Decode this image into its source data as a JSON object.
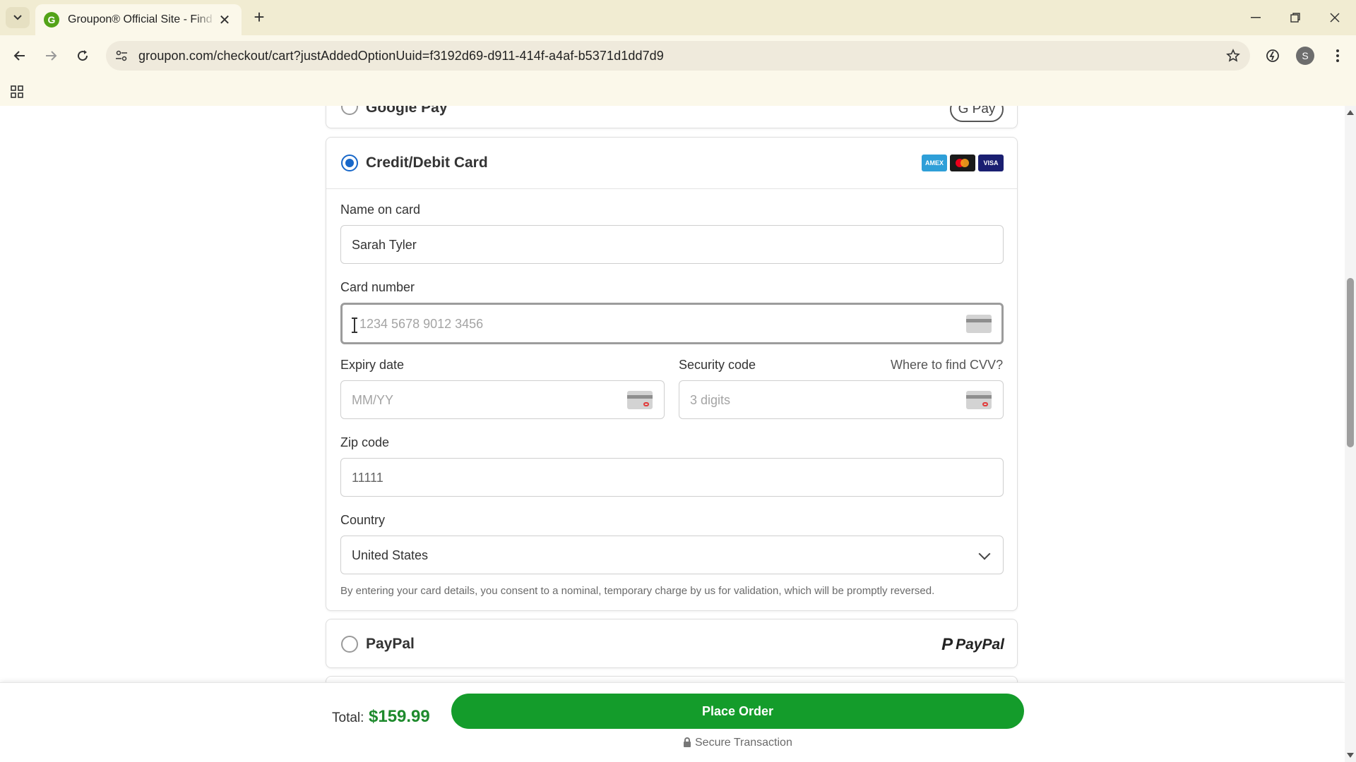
{
  "browser": {
    "tab_title": "Groupon® Official Site - Find Lo",
    "tab_favicon_letter": "G",
    "url": "groupon.com/checkout/cart?justAddedOptionUuid=f3192d69-d911-414f-a4af-b5371d1dd7d9",
    "profile_initial": "S",
    "icons": [
      "tab-list-icon",
      "close-icon",
      "plus-icon",
      "minimize-icon",
      "restore-icon",
      "close-window-icon",
      "back-icon",
      "forward-icon",
      "reload-icon",
      "site-info-icon",
      "star-icon",
      "extension-icon",
      "menu-icon",
      "apps-icon"
    ]
  },
  "payment": {
    "google_pay": {
      "label": "Google Pay",
      "badge": "G Pay"
    },
    "card": {
      "label": "Credit/Debit Card",
      "brands": [
        "AMEX",
        "MC",
        "VISA"
      ],
      "name_label": "Name on card",
      "name_value": "Sarah Tyler",
      "number_label": "Card number",
      "number_placeholder": "1234 5678 9012 3456",
      "expiry_label": "Expiry date",
      "expiry_placeholder": "MM/YY",
      "security_label": "Security code",
      "cvv_link": "Where to find CVV?",
      "security_placeholder": "3 digits",
      "zip_label": "Zip code",
      "zip_value": "11111",
      "country_label": "Country",
      "country_value": "United States",
      "consent": "By entering your card details, you consent to a nominal, temporary charge by us for validation, which will be promptly reversed."
    },
    "paypal": {
      "label": "PayPal",
      "logo": "PayPal"
    }
  },
  "footer": {
    "total_label": "Total:",
    "total_amount": "$159.99",
    "place_order": "Place Order",
    "secure": "Secure Transaction"
  },
  "colors": {
    "accent": "#149c2b",
    "total": "#1e8a2d",
    "radio": "#1767c9",
    "chrome": "#f1ecd2"
  }
}
